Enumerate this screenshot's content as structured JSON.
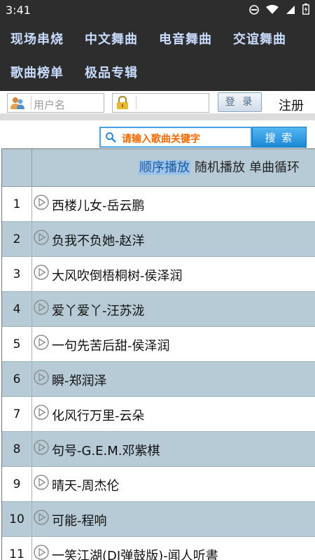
{
  "status": {
    "time": "3:41"
  },
  "nav": {
    "items": [
      "现场串烧",
      "中文舞曲",
      "电音舞曲",
      "交谊舞曲",
      "歌曲榜单",
      "极品专辑"
    ]
  },
  "login": {
    "username_placeholder": "用户名",
    "password_placeholder": "",
    "login_label": "登 录",
    "register_label": "注册"
  },
  "search": {
    "placeholder": "请输入歌曲关键字",
    "button_label": "搜 索"
  },
  "playlist": {
    "modes": [
      "顺序播放",
      "随机播放",
      "单曲循环"
    ],
    "active_mode": "顺序播放",
    "rows": [
      {
        "num": "1",
        "title": "西楼儿女-岳云鹏"
      },
      {
        "num": "2",
        "title": "负我不负她-赵洋"
      },
      {
        "num": "3",
        "title": "大风吹倒梧桐树-侯泽润"
      },
      {
        "num": "4",
        "title": "爱丫爱丫-汪苏泷"
      },
      {
        "num": "5",
        "title": "一句先苦后甜-侯泽润"
      },
      {
        "num": "6",
        "title": "瞬-郑润泽"
      },
      {
        "num": "7",
        "title": "化风行万里-云朵"
      },
      {
        "num": "8",
        "title": "句号-G.E.M.邓紫棋"
      },
      {
        "num": "9",
        "title": "晴天-周杰伦"
      },
      {
        "num": "10",
        "title": "可能-程响"
      },
      {
        "num": "11",
        "title": "一笑江湖(DJ弹鼓版)-闻人听書_"
      }
    ]
  },
  "colors": {
    "bar_bg": "#2d2d2d",
    "nav_text": "#c9dcff",
    "row_alt": "#b6cbd6",
    "search_placeholder": "#f06a00",
    "search_button": "#1b87d3"
  }
}
